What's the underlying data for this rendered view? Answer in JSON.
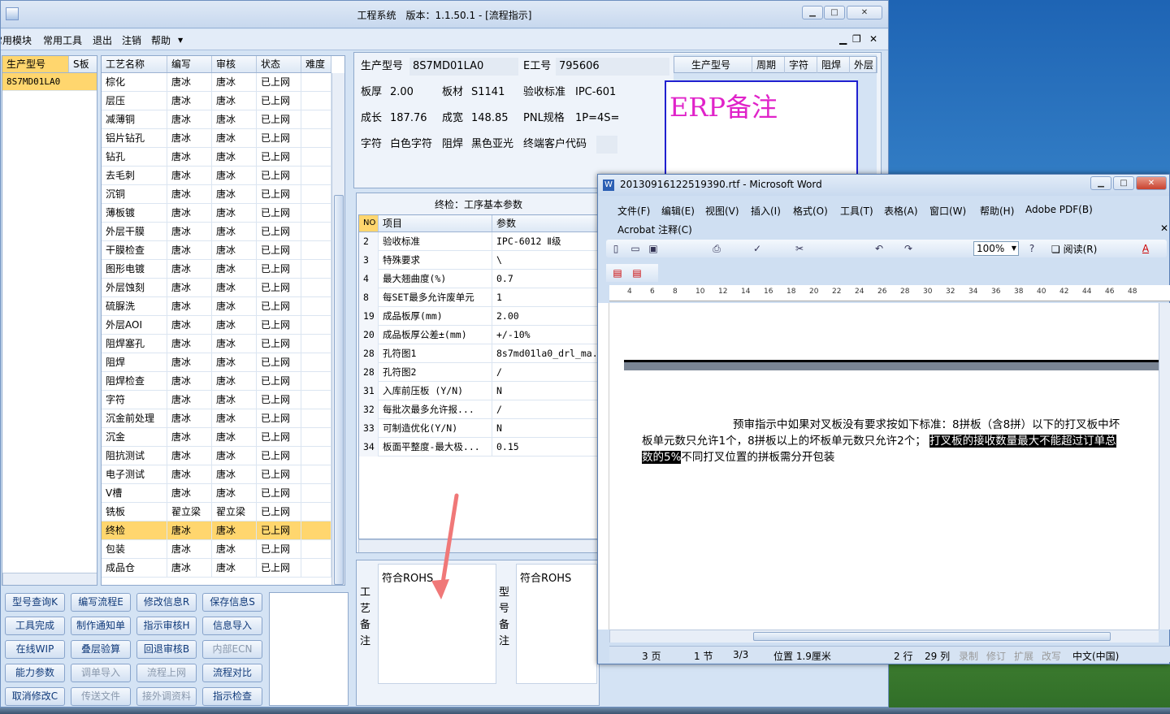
{
  "app": {
    "title": "工程系统　版本：1.1.50.1 - [流程指示]"
  },
  "menu": [
    "常用模块",
    "常用工具",
    "退出",
    "注销",
    "帮助"
  ],
  "model_grid": {
    "headers": [
      "生产型号",
      "S板"
    ],
    "rows": [
      "8S7MD01LA0"
    ]
  },
  "process_grid": {
    "headers": [
      "工艺名称",
      "编写",
      "审核",
      "状态",
      "难度"
    ],
    "rows": [
      [
        "棕化",
        "唐冰",
        "唐冰",
        "已上网"
      ],
      [
        "层压",
        "唐冰",
        "唐冰",
        "已上网"
      ],
      [
        "减薄铜",
        "唐冰",
        "唐冰",
        "已上网"
      ],
      [
        "铝片钻孔",
        "唐冰",
        "唐冰",
        "已上网"
      ],
      [
        "钻孔",
        "唐冰",
        "唐冰",
        "已上网"
      ],
      [
        "去毛刺",
        "唐冰",
        "唐冰",
        "已上网"
      ],
      [
        "沉铜",
        "唐冰",
        "唐冰",
        "已上网"
      ],
      [
        "薄板镀",
        "唐冰",
        "唐冰",
        "已上网"
      ],
      [
        "外层干膜",
        "唐冰",
        "唐冰",
        "已上网"
      ],
      [
        "干膜检查",
        "唐冰",
        "唐冰",
        "已上网"
      ],
      [
        "图形电镀",
        "唐冰",
        "唐冰",
        "已上网"
      ],
      [
        "外层蚀刻",
        "唐冰",
        "唐冰",
        "已上网"
      ],
      [
        "硫脲洗",
        "唐冰",
        "唐冰",
        "已上网"
      ],
      [
        "外层AOI",
        "唐冰",
        "唐冰",
        "已上网"
      ],
      [
        "阻焊塞孔",
        "唐冰",
        "唐冰",
        "已上网"
      ],
      [
        "阻焊",
        "唐冰",
        "唐冰",
        "已上网"
      ],
      [
        "阻焊检查",
        "唐冰",
        "唐冰",
        "已上网"
      ],
      [
        "字符",
        "唐冰",
        "唐冰",
        "已上网"
      ],
      [
        "沉金前处理",
        "唐冰",
        "唐冰",
        "已上网"
      ],
      [
        "沉金",
        "唐冰",
        "唐冰",
        "已上网"
      ],
      [
        "阻抗测试",
        "唐冰",
        "唐冰",
        "已上网"
      ],
      [
        "电子测试",
        "唐冰",
        "唐冰",
        "已上网"
      ],
      [
        "V槽",
        "唐冰",
        "唐冰",
        "已上网"
      ],
      [
        "铣板",
        "翟立梁",
        "翟立梁",
        "已上网"
      ],
      [
        "终检",
        "唐冰",
        "唐冰",
        "已上网"
      ],
      [
        "包装",
        "唐冰",
        "唐冰",
        "已上网"
      ],
      [
        "成品仓",
        "唐冰",
        "唐冰",
        "已上网"
      ]
    ],
    "selected_index": 24
  },
  "buttons": [
    [
      "型号查询K",
      "编写流程E",
      "修改信息R",
      "保存信息S"
    ],
    [
      "工具完成",
      "制作通知单",
      "指示审核H",
      "信息导入"
    ],
    [
      "在线WIP",
      "叠层验算",
      "回退审核B",
      "内部ECN"
    ],
    [
      "能力参数",
      "调单导入",
      "流程上网",
      "流程对比"
    ],
    [
      "取消修改C",
      "传送文件",
      "接外调资料",
      "指示检查"
    ]
  ],
  "disabled_buttons": [
    "内部ECN",
    "调单导入",
    "流程上网",
    "传送文件",
    "接外调资料"
  ],
  "info": {
    "labels": {
      "model": "生产型号",
      "e_no": "E工号",
      "thickness": "板厚",
      "material": "板材",
      "standard": "验收标准",
      "length": "成长",
      "width": "成宽",
      "pnl": "PNL规格",
      "char": "字符",
      "mask": "阻焊",
      "customer": "终端客户代码"
    },
    "values": {
      "model": "8S7MD01LA0",
      "e_no": "795606",
      "thickness": "2.00",
      "material": "S1141",
      "standard": "IPC-601",
      "length": "187.76",
      "width": "148.85",
      "pnl": "1P=4S=",
      "char": "白色字符",
      "mask": "黑色亚光",
      "customer": ""
    }
  },
  "side_grid": {
    "headers": [
      "生产型号",
      "周期",
      "字符",
      "阻焊",
      "外层"
    ]
  },
  "erp_note": "ERP备注",
  "param_panel": {
    "title": "终检：工序基本参数",
    "headers": [
      "NO",
      "项目",
      "参数"
    ],
    "rows": [
      [
        "2",
        "验收标准",
        "IPC-6012 Ⅱ级"
      ],
      [
        "3",
        "特殊要求",
        "\\"
      ],
      [
        "4",
        "最大翘曲度(%)",
        "0.7"
      ],
      [
        "8",
        "每SET最多允许废单元",
        "1"
      ],
      [
        "19",
        "成品板厚(mm)",
        "2.00"
      ],
      [
        "20",
        "成品板厚公差±(mm)",
        "+/-10%"
      ],
      [
        "28",
        "孔符图1",
        "8s7md01la0_drl_ma..."
      ],
      [
        "28",
        "孔符图2",
        "/"
      ],
      [
        "31",
        "入库前压板 (Y/N)",
        "N"
      ],
      [
        "32",
        "每批次最多允许报...",
        "/"
      ],
      [
        "33",
        "可制造优化(Y/N)",
        "N"
      ],
      [
        "34",
        "板面平整度-最大极...",
        "0.15"
      ]
    ]
  },
  "notes": {
    "process_label": "工艺备注",
    "process_text": "符合ROHS",
    "model_label": "型号备注",
    "model_text": "符合ROHS"
  },
  "word": {
    "title": "20130916122519390.rtf - Microsoft Word",
    "menu": [
      "文件(F)",
      "编辑(E)",
      "视图(V)",
      "插入(I)",
      "格式(O)",
      "工具(T)",
      "表格(A)",
      "窗口(W)",
      "帮助(H)",
      "Adobe PDF(B)"
    ],
    "menu2": "Acrobat 注释(C)",
    "zoom": "100%",
    "read": "阅读(R)",
    "ruler": [
      "4",
      "6",
      "8",
      "10",
      "12",
      "14",
      "16",
      "18",
      "20",
      "22",
      "24",
      "26",
      "28",
      "30",
      "32",
      "34",
      "36",
      "38",
      "40",
      "42",
      "44",
      "46",
      "48"
    ],
    "doc_line1": "预审指示中如果对叉板没有要求按如下标准：8拼板（含8拼）以下的打叉板中坏",
    "doc_line2a": "板单元数只允许1个，8拼板以上的坏板单元数只允许2个；",
    "doc_line2b": "打叉板的接收数量最大不能超过订单总",
    "doc_line3a": "数的5%",
    "doc_line3b": "不同打叉位置的拼板需分开包装",
    "status": {
      "page": "3 页",
      "section": "1 节",
      "pages": "3/3",
      "pos": "位置 1.9厘米",
      "line": "2 行",
      "col": "29 列",
      "rec": "录制",
      "trk": "修订",
      "ext": "扩展",
      "ovr": "改写",
      "lang": "中文(中国)"
    }
  },
  "colors": {
    "accent": "#ffd66e",
    "erp": "#e023c9",
    "arrow": "#f07878",
    "border": "#2020d0"
  }
}
